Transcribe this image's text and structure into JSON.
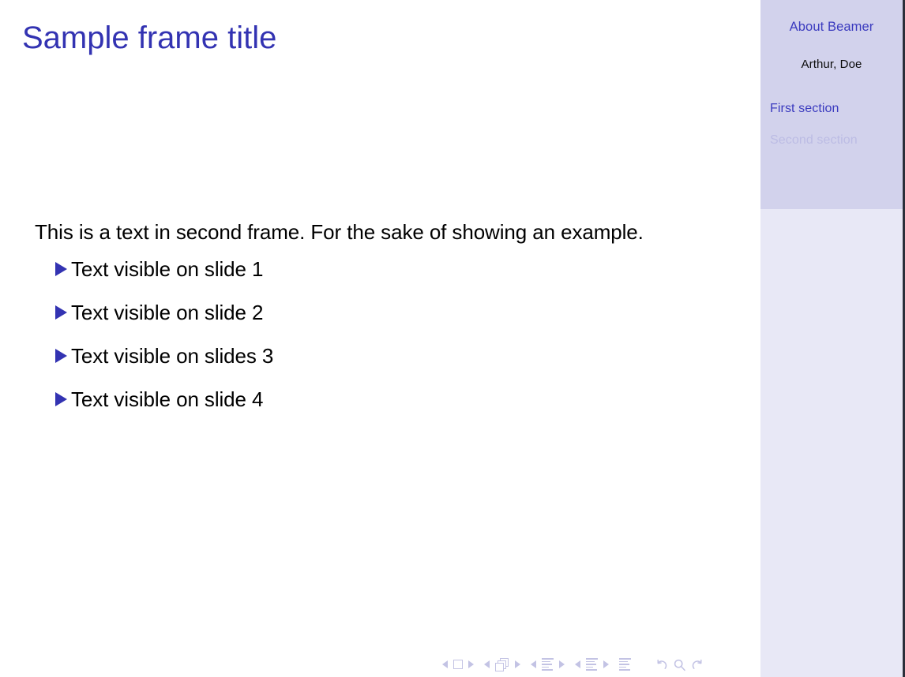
{
  "theme": {
    "accent_color": "#3333B2",
    "sidebar_title_color": "#3B3BBF",
    "sidebar_bg_top": "#D2D2EC",
    "sidebar_bg_bottom": "#E8E8F6",
    "inactive_section_color": "#BCBCE4",
    "nav_symbol_color": "#C3C3E4",
    "body_text_color": "#000000",
    "page_bg": "#FFFFFF"
  },
  "sidebar": {
    "title": "About Beamer",
    "author": "Arthur, Doe",
    "sections": [
      {
        "label": "First section",
        "state": "active"
      },
      {
        "label": "Second section",
        "state": "inactive"
      }
    ]
  },
  "frame": {
    "title": "Sample frame title",
    "paragraph": "This is a text in second frame. For the sake of showing an example.",
    "items": [
      {
        "bullet": "triangle-right-icon",
        "text": "Text visible on slide 1"
      },
      {
        "bullet": "triangle-right-icon",
        "text": "Text visible on slide 2"
      },
      {
        "bullet": "triangle-right-icon",
        "text": "Text visible on slides 3"
      },
      {
        "bullet": "triangle-right-icon",
        "text": "Text visible on slide 4"
      }
    ]
  },
  "navigation_symbols": {
    "groups": [
      {
        "name": "slide-navigation",
        "icon": "square-icon"
      },
      {
        "name": "frame-navigation",
        "icon": "stacked-squares-icon"
      },
      {
        "name": "subsection-navigation",
        "icon": "lines-icon"
      },
      {
        "name": "section-navigation",
        "icon": "lines-icon"
      }
    ],
    "document_icon": "document-lines-icon",
    "tail": [
      {
        "name": "back-icon"
      },
      {
        "name": "search-icon"
      },
      {
        "name": "forward-icon"
      }
    ]
  }
}
